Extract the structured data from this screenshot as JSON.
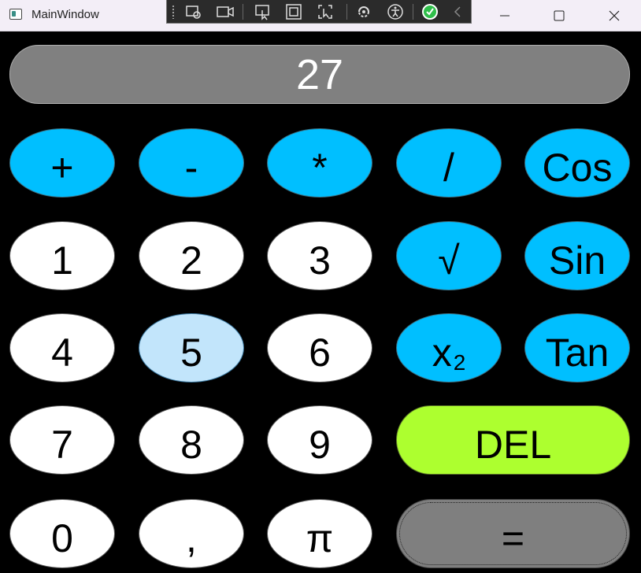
{
  "window": {
    "title": "MainWindow",
    "icon": "app-window-icon"
  },
  "devtools": {
    "icons": [
      "grip-icon",
      "select-element-icon",
      "record-icon",
      "select-cursor-icon",
      "layout-bounds-icon",
      "track-focus-icon",
      "hot-reload-icon",
      "accessibility-icon",
      "check-circle-icon",
      "collapse-icon"
    ],
    "accent": "#2fbe4a"
  },
  "controls": {
    "minimize": "minimize-icon",
    "maximize": "maximize-icon",
    "close": "close-icon"
  },
  "display": {
    "value": "27"
  },
  "buttons": {
    "plus": "+",
    "minus": "-",
    "multiply": "*",
    "divide": "/",
    "cos": "Cos",
    "one": "1",
    "two": "2",
    "three": "3",
    "sqrt": "√",
    "sin": "Sin",
    "four": "4",
    "five": "5",
    "six": "6",
    "square_base": "x",
    "square_exp": "2",
    "tan": "Tan",
    "seven": "7",
    "eight": "8",
    "nine": "9",
    "del": "DEL",
    "zero": "0",
    "comma": ",",
    "pi": "π",
    "equals": "="
  },
  "colors": {
    "operator": "#00BFFF",
    "number": "#FFFFFF",
    "hover": "#C2E5FB",
    "delete": "#ADFF2F",
    "equals": "#7F7F7F",
    "display": "#808080",
    "background": "#000000"
  }
}
